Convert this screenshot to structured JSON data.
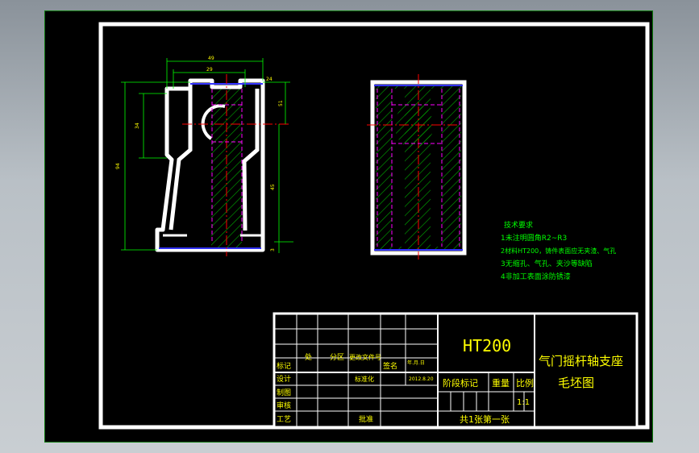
{
  "colors": {
    "background": "#000000",
    "frame": "#ffffff",
    "outer_border": "#00aa00",
    "title_text": "#ffff00",
    "outline": "#ffffff",
    "hatch": "#00aa00",
    "dimension": "#00ff00",
    "centerline": "#ff0000",
    "hidden": "#ff00ff",
    "tech_text": "#00ff00"
  },
  "front_view": {
    "dims": {
      "top_width": "49",
      "upper_width": "29",
      "mid_height": "45",
      "total_height": "94",
      "left_height": "34",
      "bottom": "3",
      "top_right": "24",
      "right_upper": "51"
    }
  },
  "tech": {
    "title": "技术要求",
    "items": [
      "1未注明圆角R2~R3",
      "2材料HT200，铸件表面应无夹渣、气孔",
      "3无缩孔、气孔、夹沙等缺陷",
      "4非加工表面涂防锈漆"
    ]
  },
  "title_block": {
    "material": "HT200",
    "part_name_1": "气门摇杆轴支座",
    "part_name_2": "毛坯图",
    "headers": {
      "mark": "标记",
      "count": "处",
      "zone": "分区",
      "file": "更改文件号",
      "sign": "签名",
      "date": "年.月.日"
    },
    "rows": {
      "design": "设计",
      "standard": "标准化",
      "draw": "制图",
      "check": "审核",
      "process": "工艺",
      "approve": "批准",
      "date_value": "2012.8.20"
    },
    "stage": "阶段标记",
    "weight": "重量",
    "scale": "比例",
    "scale_value": "1:1",
    "sheets": "共1张第一张"
  }
}
